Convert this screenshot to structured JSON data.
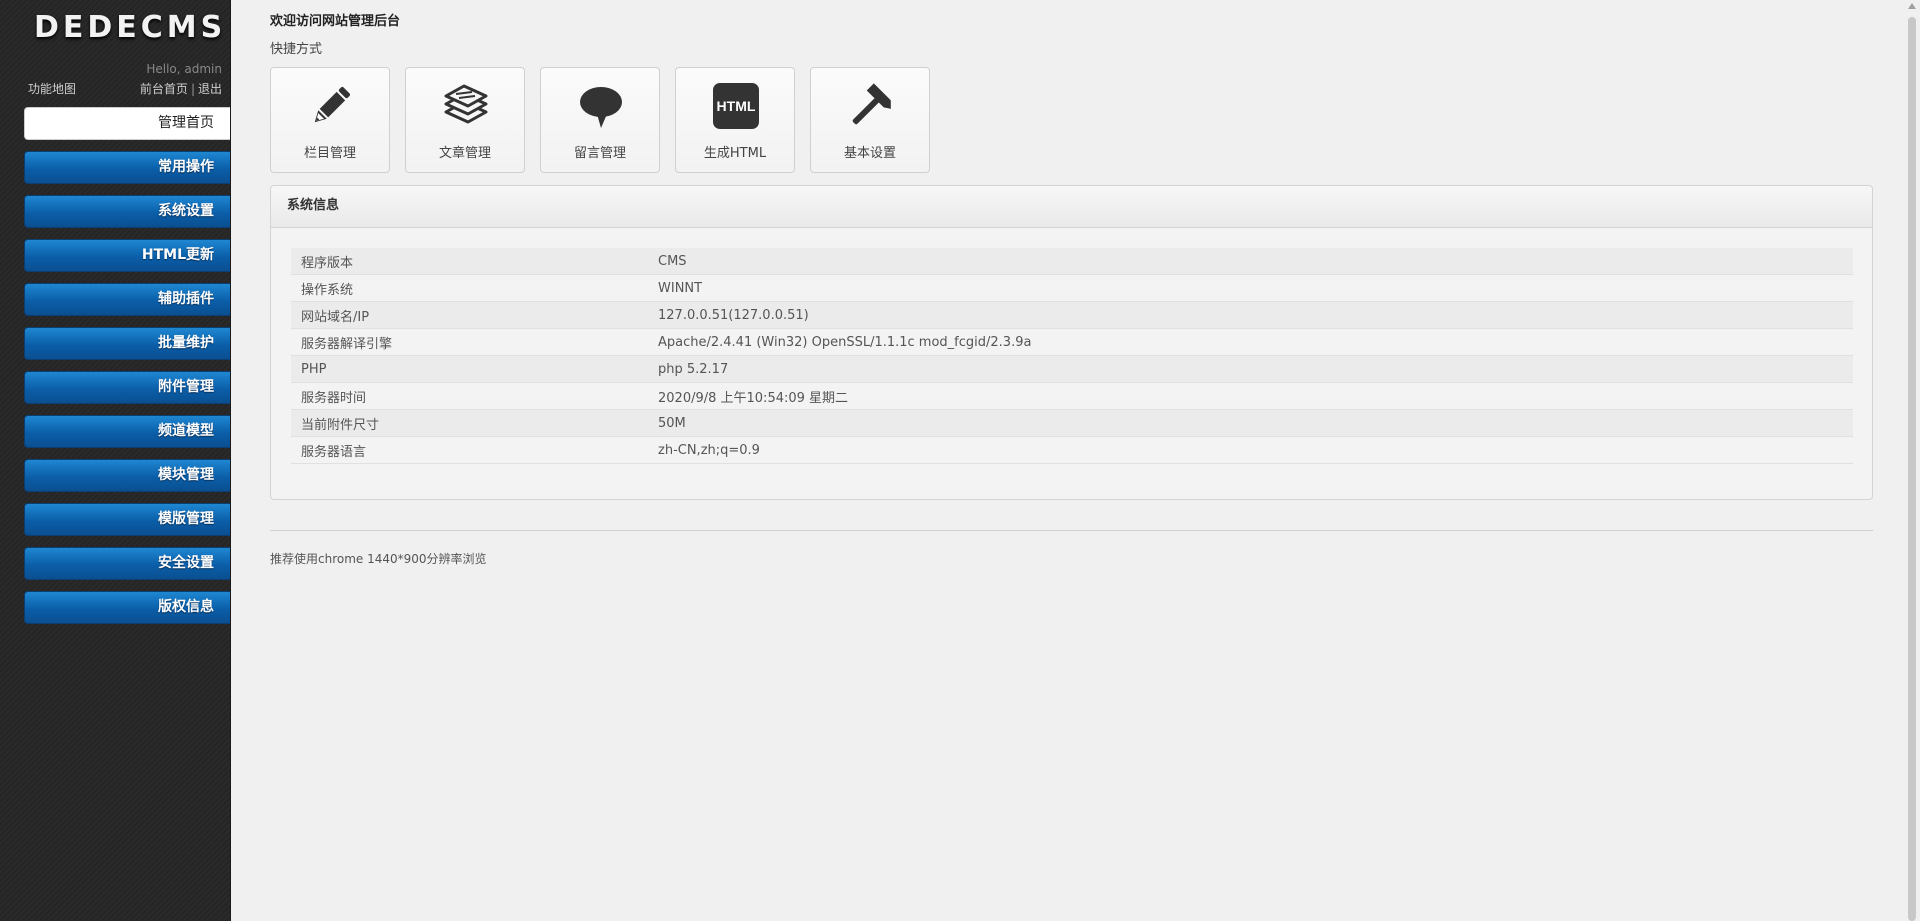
{
  "sidebar": {
    "logo": "DEDECMS",
    "hello": "Hello, admin",
    "sitemap": "功能地图",
    "front_link": "前台首页",
    "separator": "|",
    "logout": "退出",
    "items": [
      {
        "label": "管理首页",
        "active": true
      },
      {
        "label": "常用操作"
      },
      {
        "label": "系统设置"
      },
      {
        "label": "HTML更新"
      },
      {
        "label": "辅助插件"
      },
      {
        "label": "批量维护"
      },
      {
        "label": "附件管理"
      },
      {
        "label": "频道模型"
      },
      {
        "label": "模块管理"
      },
      {
        "label": "模版管理"
      },
      {
        "label": "安全设置"
      },
      {
        "label": "版权信息"
      }
    ]
  },
  "main": {
    "welcome": "欢迎访问网站管理后台",
    "shortcut_title": "快捷方式",
    "shortcuts": [
      {
        "label": "栏目管理",
        "icon": "pencil-icon"
      },
      {
        "label": "文章管理",
        "icon": "document-stack-icon"
      },
      {
        "label": "留言管理",
        "icon": "speech-bubble-icon"
      },
      {
        "label": "生成HTML",
        "icon": "html-icon",
        "icon_text": "HTML"
      },
      {
        "label": "基本设置",
        "icon": "hammer-icon"
      }
    ],
    "system_info": {
      "title": "系统信息",
      "rows": [
        {
          "key": "程序版本",
          "value": "CMS"
        },
        {
          "key": "操作系统",
          "value": "WINNT"
        },
        {
          "key": "网站域名/IP",
          "value": "127.0.0.51(127.0.0.51)"
        },
        {
          "key": "服务器解译引擎",
          "value": "Apache/2.4.41 (Win32) OpenSSL/1.1.1c mod_fcgid/2.3.9a"
        },
        {
          "key": "PHP",
          "value": "php 5.2.17"
        },
        {
          "key": "服务器时间",
          "value": "2020/9/8 上午10:54:09 星期二"
        },
        {
          "key": "当前附件尺寸",
          "value": "50M"
        },
        {
          "key": "服务器语言",
          "value": "zh-CN,zh;q=0.9"
        }
      ]
    },
    "footer": "推荐使用chrome 1440*900分辨率浏览"
  },
  "colors": {
    "menu_blue": "#0b5ea8",
    "sidebar_bg": "#2a2a2a",
    "page_bg": "#f0f0f0"
  }
}
